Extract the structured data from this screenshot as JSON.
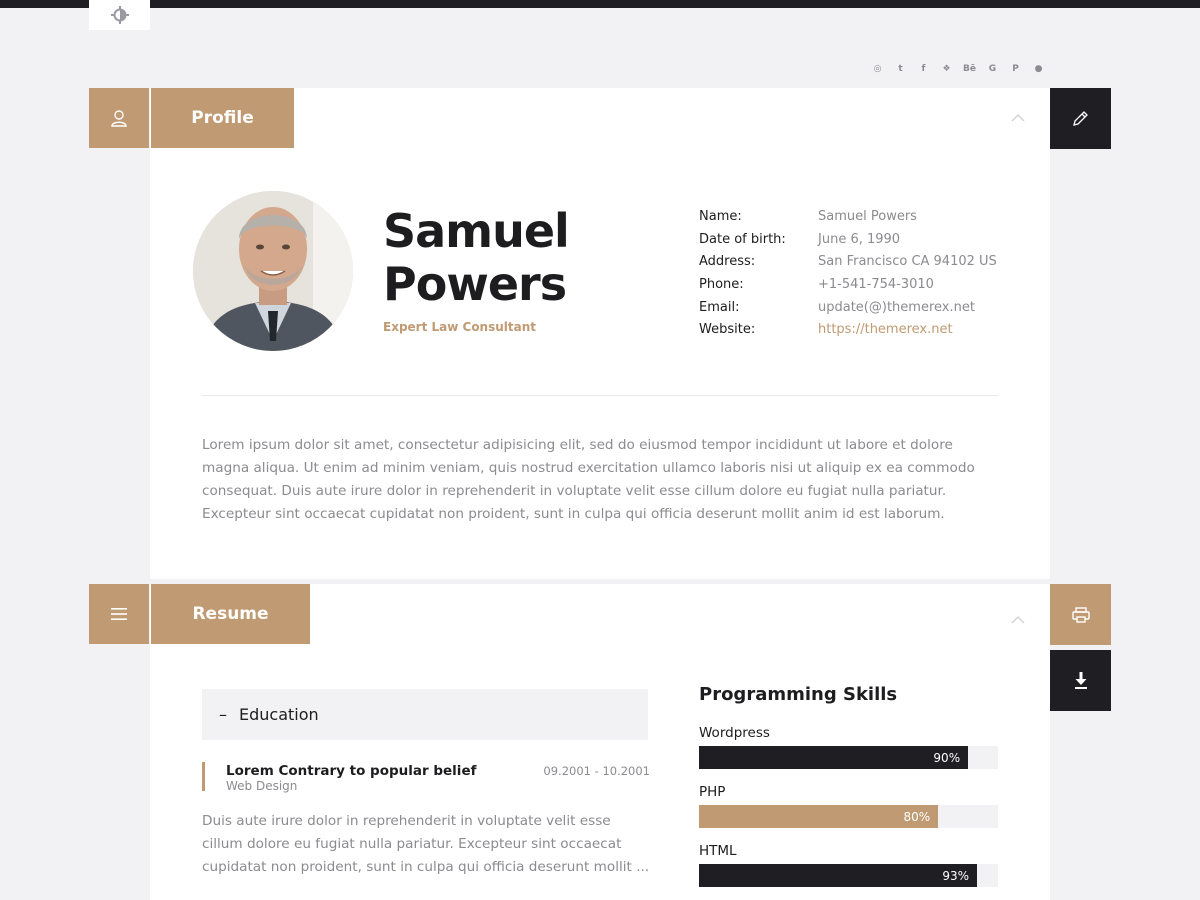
{
  "colors": {
    "accent": "#c09a72",
    "dark": "#1f1f23",
    "muted": "#8b8b90"
  },
  "socials": [
    {
      "icon": "instagram-icon",
      "glyph": "◎"
    },
    {
      "icon": "twitter-icon",
      "glyph": "t"
    },
    {
      "icon": "facebook-icon",
      "glyph": "f"
    },
    {
      "icon": "dropbox-icon",
      "glyph": "❖"
    },
    {
      "icon": "behance-icon",
      "glyph": "Bē"
    },
    {
      "icon": "google-icon",
      "glyph": "G"
    },
    {
      "icon": "pinterest-icon",
      "glyph": "P"
    },
    {
      "icon": "evernote-icon",
      "glyph": "●"
    }
  ],
  "profile": {
    "section_title": "Profile",
    "name_line1": "Samuel",
    "name_line2": "Powers",
    "role": "Expert Law Consultant",
    "info": [
      {
        "key": "Name:",
        "value": "Samuel Powers",
        "link": false
      },
      {
        "key": "Date of birth:",
        "value": "June 6, 1990",
        "link": false
      },
      {
        "key": "Address:",
        "value": "San Francisco CA 94102 US",
        "link": false
      },
      {
        "key": "Phone:",
        "value": "+1-541-754-3010",
        "link": false
      },
      {
        "key": "Email:",
        "value": "update(@)themerex.net",
        "link": false
      },
      {
        "key": "Website:",
        "value": "https://themerex.net",
        "link": true
      }
    ],
    "bio": "Lorem ipsum dolor sit amet, consectetur adipisicing elit, sed do eiusmod tempor incididunt ut labore et dolore magna aliqua. Ut enim ad minim veniam, quis nostrud exercitation ullamco laboris nisi ut aliquip ex ea commodo consequat. Duis aute irure dolor in reprehenderit in voluptate velit esse cillum dolore eu fugiat nulla pariatur. Excepteur sint occaecat cupidatat non proident, sunt in culpa qui officia deserunt mollit anim id est laborum."
  },
  "resume": {
    "section_title": "Resume",
    "education": {
      "toggle": "–",
      "heading": "Education",
      "entry_title": "Lorem Contrary to popular belief",
      "entry_subtitle": "Web Design",
      "entry_date": "09.2001 - 10.2001",
      "entry_text": "Duis aute irure dolor in reprehenderit in voluptate velit esse cillum dolore eu fugiat nulla pariatur. Excepteur sint occaecat cupidatat non proident, sunt in culpa qui officia deserunt mollit ..."
    },
    "skills_title": "Programming Skills",
    "skills": [
      {
        "label": "Wordpress",
        "percent": 90,
        "percent_label": "90%",
        "color": "#1f1f23"
      },
      {
        "label": "PHP",
        "percent": 80,
        "percent_label": "80%",
        "color": "#c09a72"
      },
      {
        "label": "HTML",
        "percent": 93,
        "percent_label": "93%",
        "color": "#1f1f23"
      }
    ]
  }
}
